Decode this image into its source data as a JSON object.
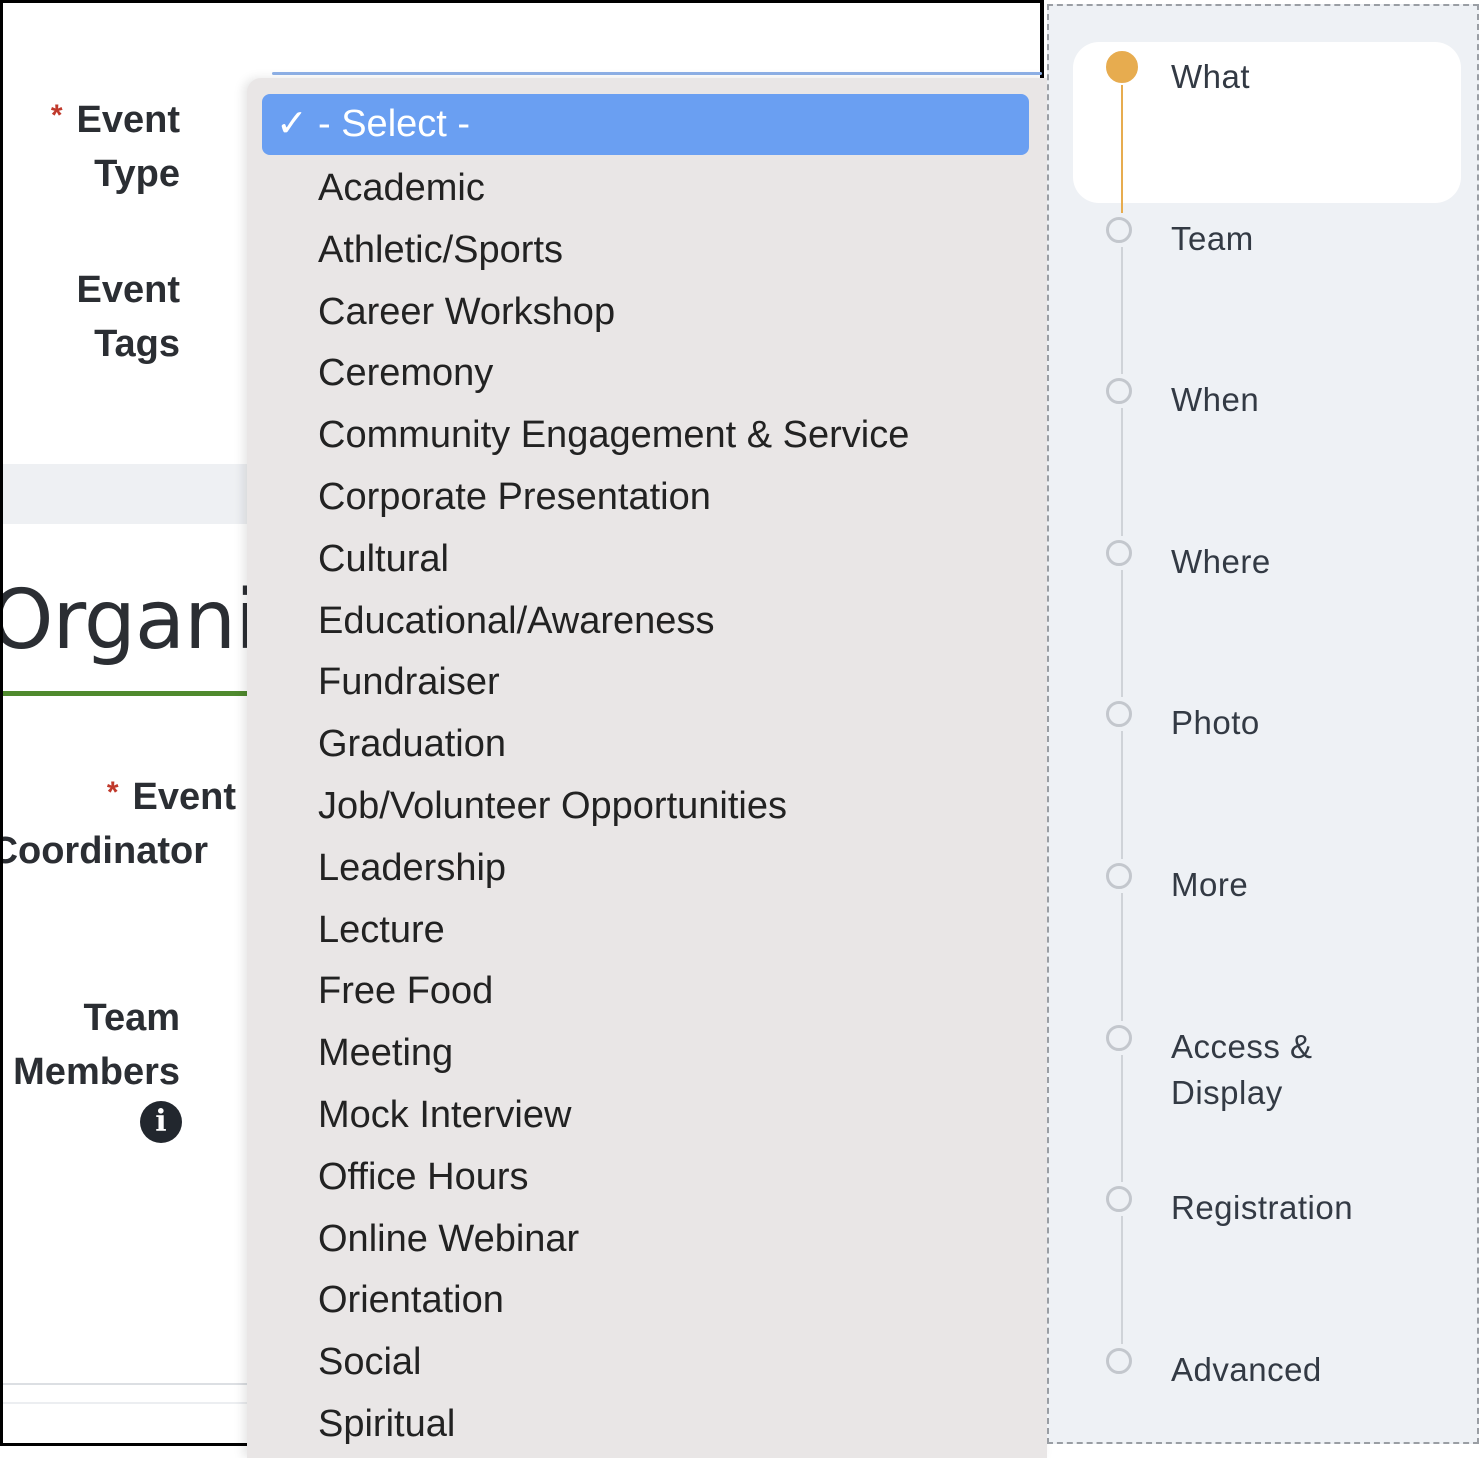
{
  "form": {
    "event_type_label": [
      "Event",
      "Type"
    ],
    "event_tags_label": [
      "Event",
      "Tags"
    ],
    "section_heading": "Organiz",
    "event_coordinator_label": [
      "Event",
      "Coordinator"
    ],
    "team_members_label": [
      "Team",
      "Members"
    ],
    "required_marker": "*",
    "info_icon_glyph": "i"
  },
  "dropdown": {
    "selected": "- Select -",
    "check_glyph": "✓",
    "options": [
      "Academic",
      "Athletic/Sports",
      "Career Workshop",
      "Ceremony",
      "Community Engagement & Service",
      "Corporate Presentation",
      "Cultural",
      "Educational/Awareness",
      "Fundraiser",
      "Graduation",
      "Job/Volunteer Opportunities",
      "Leadership",
      "Lecture",
      "Free Food",
      "Meeting",
      "Mock Interview",
      "Office Hours",
      "Online Webinar",
      "Orientation",
      "Social",
      "Spiritual"
    ]
  },
  "steps": {
    "items": [
      {
        "label": "What",
        "active": true
      },
      {
        "label": "Team",
        "active": false
      },
      {
        "label": "When",
        "active": false
      },
      {
        "label": "Where",
        "active": false
      },
      {
        "label": "Photo",
        "active": false
      },
      {
        "label": "More",
        "active": false
      },
      {
        "label": "Access &",
        "label2": "Display",
        "active": false
      },
      {
        "label": "Registration",
        "active": false
      },
      {
        "label": "Advanced",
        "active": false
      }
    ]
  },
  "colors": {
    "selected_option_bg": "#6a9ff2",
    "active_step": "#e7ac4f",
    "section_rule": "#4f8a2e",
    "required": "#c0392b"
  }
}
